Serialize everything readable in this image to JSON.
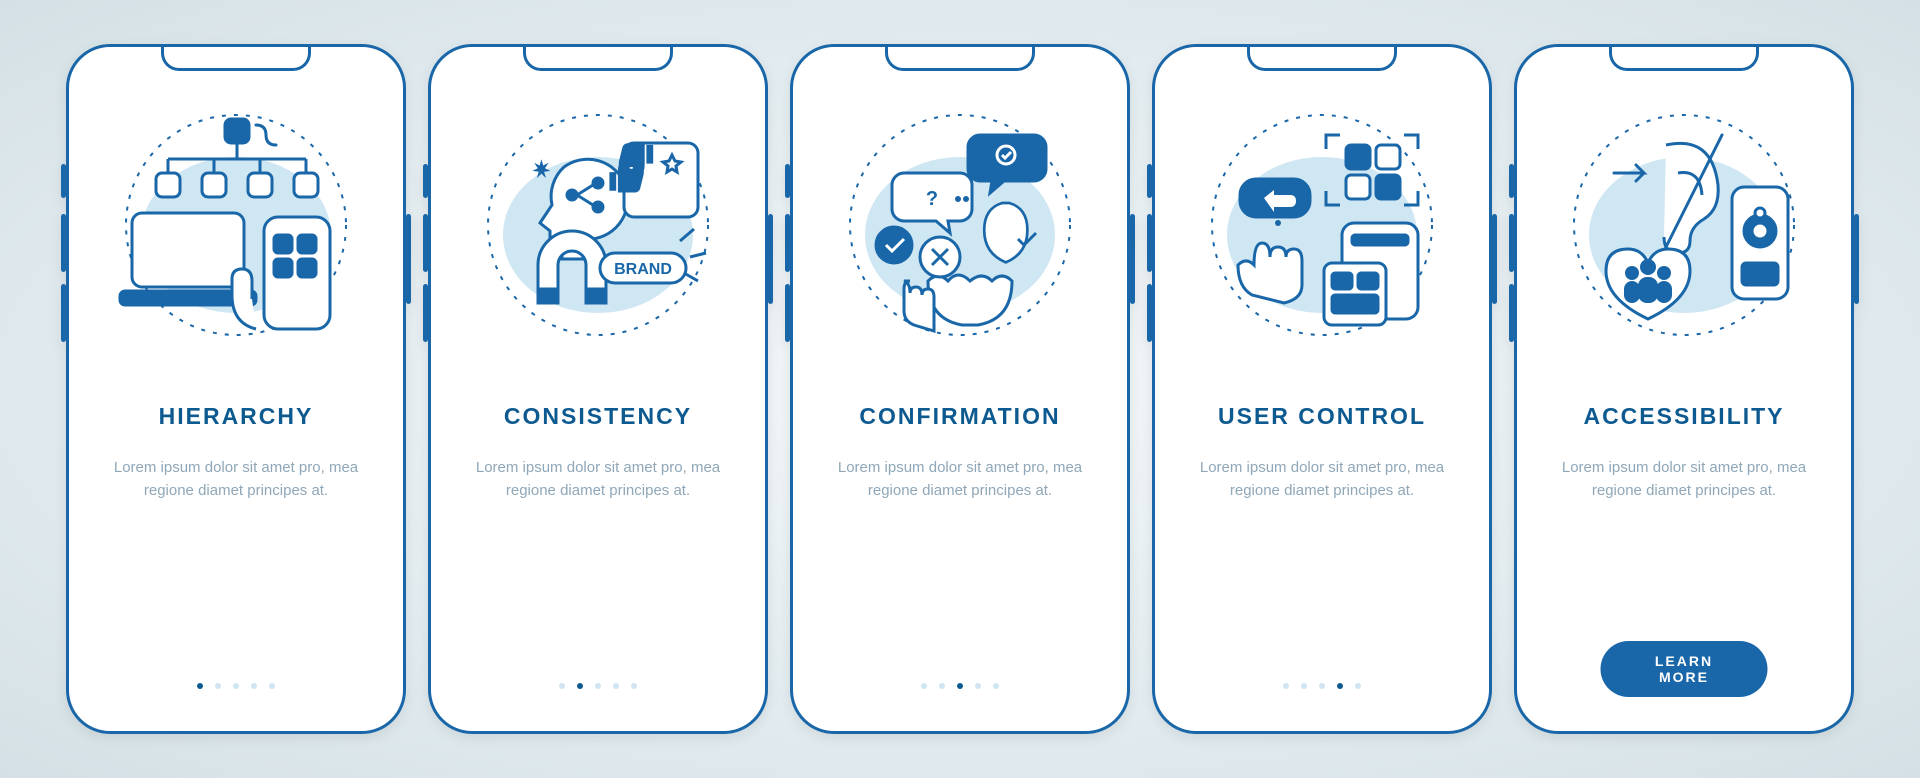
{
  "colors": {
    "accent": "#1967a8",
    "accent_dark": "#0d5a91",
    "body_text": "#8fa7b8",
    "light": "#cfe6f3"
  },
  "cta_label": "LEARN MORE",
  "dots_total": 5,
  "screens": [
    {
      "title": "HIERARCHY",
      "body": "Lorem ipsum dolor sit amet pro, mea regione diamet principes at.",
      "icon_name": "hierarchy-icon"
    },
    {
      "title": "CONSISTENCY",
      "body": "Lorem ipsum dolor sit amet pro, mea regione diamet principes at.",
      "icon_name": "consistency-icon"
    },
    {
      "title": "CONFIRMATION",
      "body": "Lorem ipsum dolor sit amet pro, mea regione diamet principes at.",
      "icon_name": "confirmation-icon"
    },
    {
      "title": "USER CONTROL",
      "body": "Lorem ipsum dolor sit amet pro, mea regione diamet principes at.",
      "icon_name": "user-control-icon"
    },
    {
      "title": "ACCESSIBILITY",
      "body": "Lorem ipsum dolor sit amet pro, mea regione diamet principes at.",
      "icon_name": "accessibility-icon"
    }
  ]
}
